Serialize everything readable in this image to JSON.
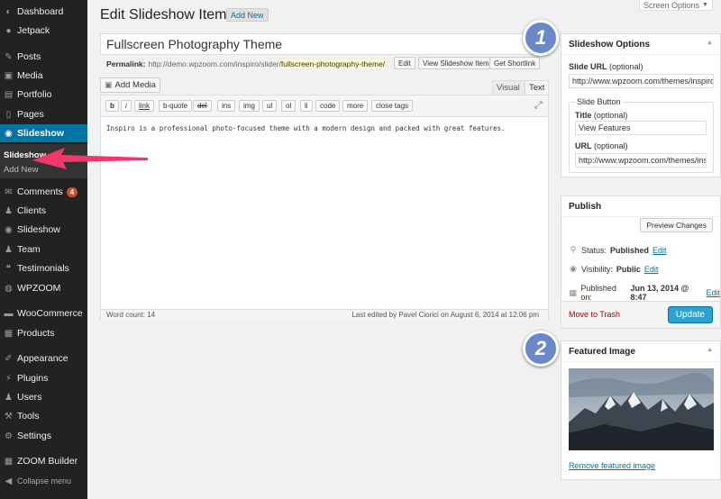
{
  "sidebar": {
    "items": [
      {
        "label": "Dashboard",
        "icon": "dashboard-icon",
        "glyph": "◐"
      },
      {
        "label": "Jetpack",
        "icon": "jetpack-icon",
        "glyph": "●"
      },
      {
        "label": "Posts",
        "icon": "pushpin-icon",
        "glyph": "✎"
      },
      {
        "label": "Media",
        "icon": "media-icon",
        "glyph": "▣"
      },
      {
        "label": "Portfolio",
        "icon": "portfolio-icon",
        "glyph": "▤"
      },
      {
        "label": "Pages",
        "icon": "pages-icon",
        "glyph": "▯"
      },
      {
        "label": "Slideshow",
        "icon": "slideshow-icon",
        "glyph": "◉"
      },
      {
        "label": "Comments",
        "icon": "comments-icon",
        "glyph": "✉",
        "badge": "4"
      },
      {
        "label": "Clients",
        "icon": "clients-icon",
        "glyph": "♟"
      },
      {
        "label": "Slideshow",
        "icon": "slideshow-icon",
        "glyph": "◉"
      },
      {
        "label": "Team",
        "icon": "team-icon",
        "glyph": "♟"
      },
      {
        "label": "Testimonials",
        "icon": "quote-icon",
        "glyph": "❝"
      },
      {
        "label": "WPZOOM",
        "icon": "wpzoom-icon",
        "glyph": "◍"
      },
      {
        "label": "WooCommerce",
        "icon": "woocommerce-icon",
        "glyph": "▬"
      },
      {
        "label": "Products",
        "icon": "products-icon",
        "glyph": "▦"
      },
      {
        "label": "Appearance",
        "icon": "brush-icon",
        "glyph": "✐"
      },
      {
        "label": "Plugins",
        "icon": "plugins-icon",
        "glyph": "⚡"
      },
      {
        "label": "Users",
        "icon": "users-icon",
        "glyph": "♟"
      },
      {
        "label": "Tools",
        "icon": "tools-icon",
        "glyph": "⚒"
      },
      {
        "label": "Settings",
        "icon": "settings-icon",
        "glyph": "⚙"
      },
      {
        "label": "ZOOM Builder",
        "icon": "zoom-builder-icon",
        "glyph": "▦"
      },
      {
        "label": "Collapse menu",
        "icon": "collapse-icon",
        "glyph": "◀"
      }
    ],
    "submenu": {
      "current": "Slideshow",
      "add_new": "Add New"
    }
  },
  "screen_options": "Screen Options",
  "header": {
    "title": "Edit Slideshow Item",
    "add_new": "Add New"
  },
  "post": {
    "title": "Fullscreen Photography Theme"
  },
  "permalink": {
    "label": "Permalink:",
    "base": "http://demo.wpzoom.com/inspiro/slider/",
    "slug": "fullscreen-photography-theme/",
    "buttons": [
      "Edit",
      "View Slideshow Item",
      "Get Shortlink"
    ]
  },
  "editor": {
    "add_media": "Add Media",
    "tabs": [
      "Visual",
      "Text"
    ],
    "quicktags": [
      "b",
      "i",
      "link",
      "b-quote",
      "del",
      "ins",
      "img",
      "ul",
      "ol",
      "li",
      "code",
      "more",
      "close tags"
    ],
    "content": "Inspiro is a professional photo-focused theme with a modern design and packed with great features.",
    "word_count": "Word count: 14",
    "last_edited": "Last edited by Pavel Ciorici on August 6, 2014 at 12:06 pm"
  },
  "slideshow_options": {
    "title": "Slideshow Options",
    "slide_url_label": "Slide URL",
    "optional": "(optional)",
    "slide_url_value": "http://www.wpzoom.com/themes/inspiro/",
    "button_legend": "Slide Button",
    "title_label": "Title",
    "title_value": "View Features",
    "url_label": "URL",
    "url_value": "http://www.wpzoom.com/themes/inspiro/"
  },
  "publish": {
    "title": "Publish",
    "preview": "Preview Changes",
    "status_label": "Status:",
    "status_value": "Published",
    "visibility_label": "Visibility:",
    "visibility_value": "Public",
    "published_label": "Published on:",
    "published_value": "Jun 13, 2014 @ 8:47",
    "edit": "Edit",
    "trash": "Move to Trash",
    "update": "Update"
  },
  "featured_image": {
    "title": "Featured Image",
    "remove": "Remove featured image"
  },
  "callouts": [
    "1",
    "2"
  ],
  "colors": {
    "accent": "#0074a2",
    "sidebar": "#222222",
    "arrow": "#f0386b",
    "callout": "#6b88c9"
  }
}
